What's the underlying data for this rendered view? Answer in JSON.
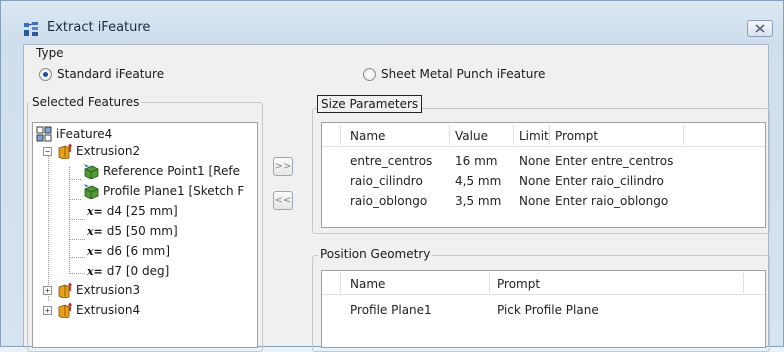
{
  "window": {
    "title": "Extract iFeature"
  },
  "type_group": {
    "label": "Type",
    "options": [
      {
        "label": "Standard iFeature",
        "selected": true
      },
      {
        "label": "Sheet Metal Punch iFeature",
        "selected": false
      }
    ]
  },
  "selected_features": {
    "label": "Selected Features",
    "root": "iFeature4",
    "items": [
      {
        "label": "Extrusion2",
        "expander": "−"
      },
      {
        "label": "Reference Point1 [Refe"
      },
      {
        "label": "Profile Plane1 [Sketch F"
      },
      {
        "label": "d4 [25 mm]",
        "prefix": "x="
      },
      {
        "label": "d5 [50 mm]",
        "prefix": "x="
      },
      {
        "label": "d6 [6 mm]",
        "prefix": "x="
      },
      {
        "label": "d7 [0 deg]",
        "prefix": "x="
      },
      {
        "label": "Extrusion3",
        "expander": "+"
      },
      {
        "label": "Extrusion4",
        "expander": "+"
      }
    ]
  },
  "buttons": {
    "add": ">>",
    "remove": "<<"
  },
  "size_parameters": {
    "label": "Size Parameters",
    "columns": [
      "Name",
      "Value",
      "Limit",
      "Prompt"
    ],
    "rows": [
      [
        "entre_centros",
        "16 mm",
        "None",
        "Enter entre_centros"
      ],
      [
        "raio_cilindro",
        "4,5 mm",
        "None",
        "Enter raio_cilindro"
      ],
      [
        "raio_oblongo",
        "3,5 mm",
        "None",
        "Enter raio_oblongo"
      ]
    ]
  },
  "position_geometry": {
    "label": "Position Geometry",
    "columns": [
      "Name",
      "Prompt"
    ],
    "rows": [
      [
        "Profile Plane1",
        "Pick Profile Plane"
      ]
    ]
  },
  "colors": {
    "radio_dot": "#1d4f9a",
    "feature_orange": "#e8a21a",
    "param_green": "#3d8a2a"
  },
  "icons": [
    "ifeature-extract-icon",
    "close-icon",
    "ifeature-icon",
    "extrusion-icon",
    "reference-point-icon",
    "sketch-icon",
    "parameter-icon"
  ]
}
